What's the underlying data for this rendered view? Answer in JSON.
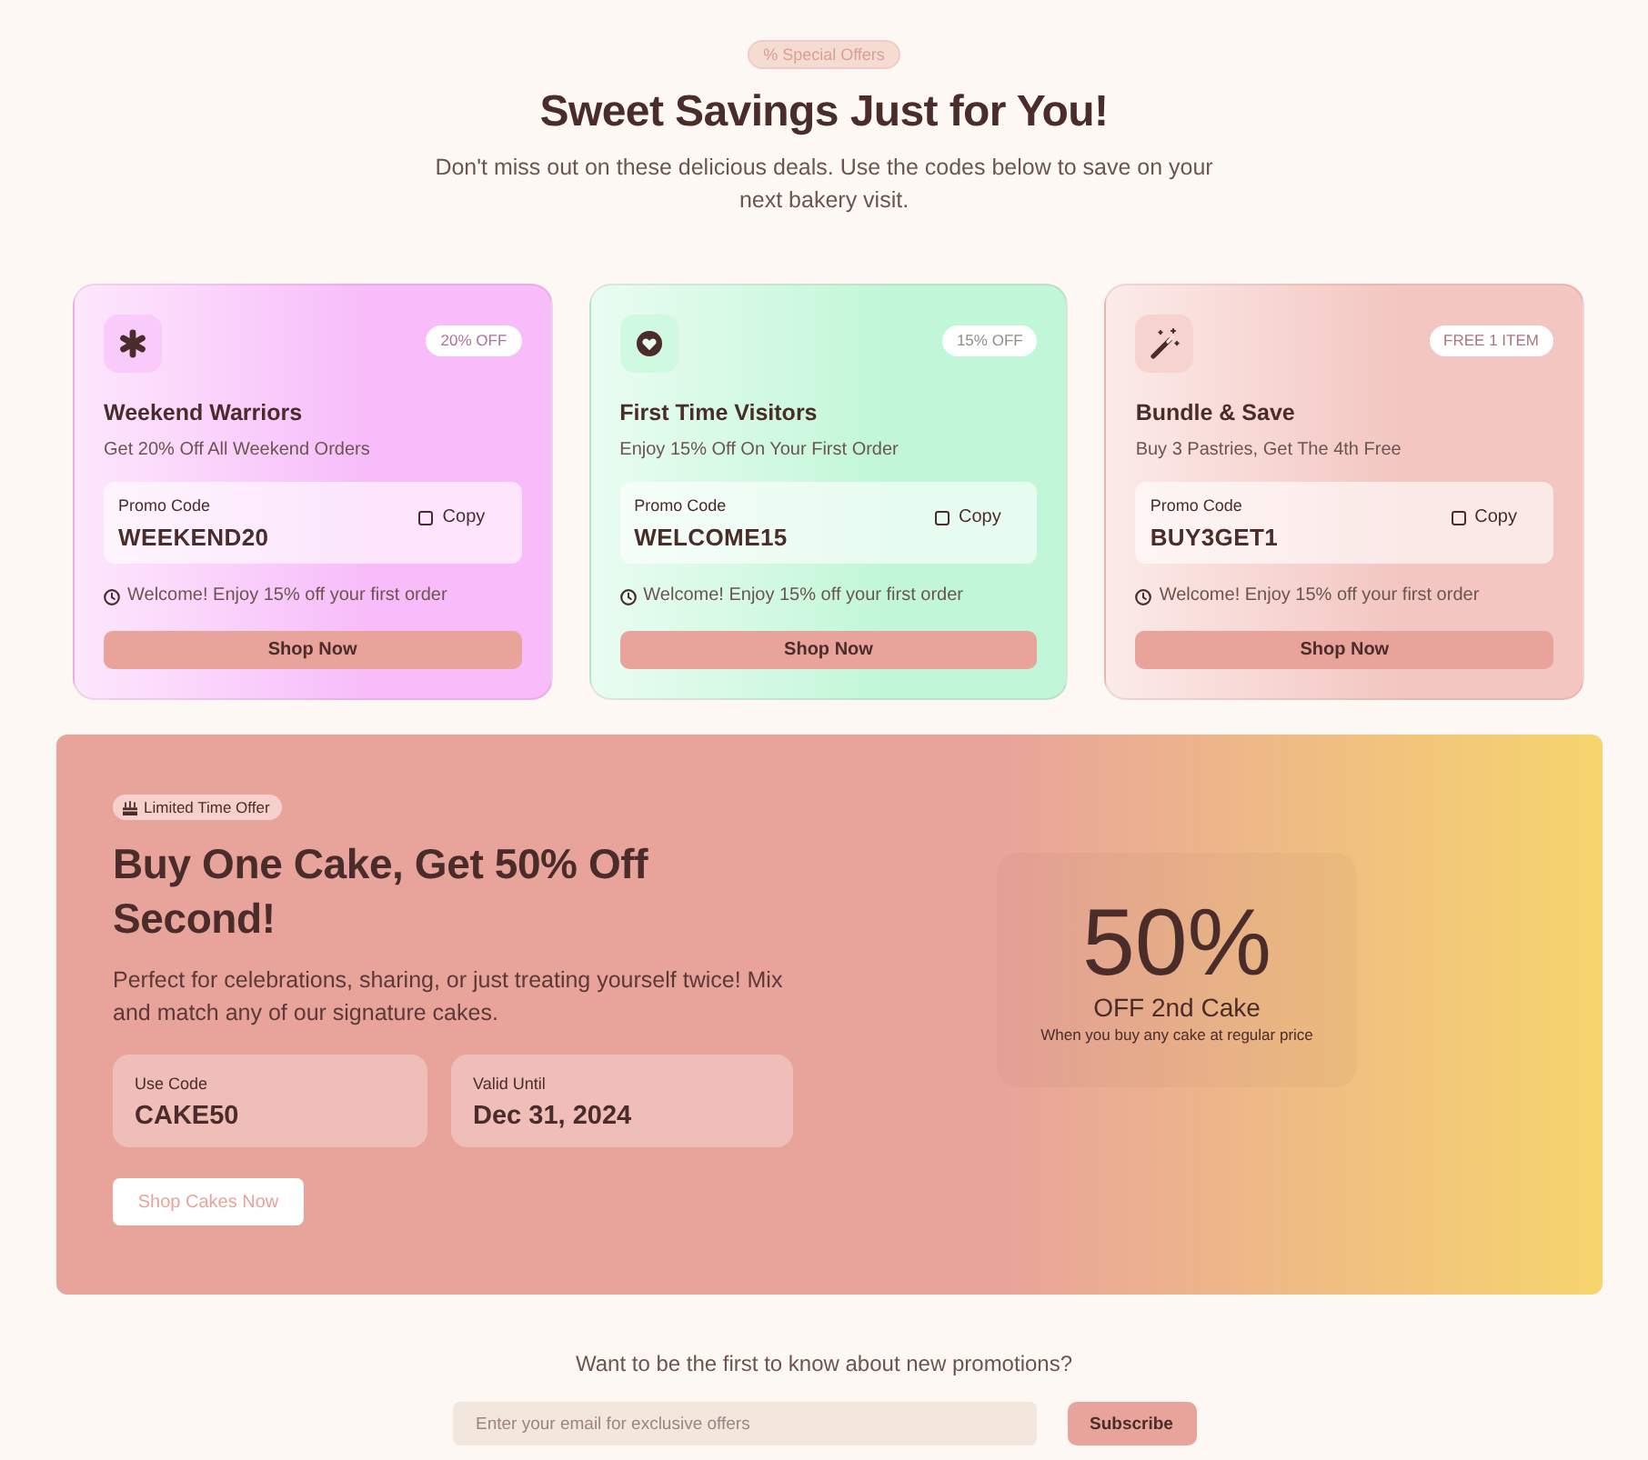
{
  "header": {
    "badge": "% Special Offers",
    "title": "Sweet Savings Just for You!",
    "subtitle": "Don't miss out on these delicious deals. Use the codes below to save on your next bakery visit."
  },
  "offers": [
    {
      "color": "#f7bcf9",
      "badge": "20% OFF",
      "title": "Weekend Warriors",
      "description": "Get 20% Off All Weekend Orders",
      "code_label": "Promo Code",
      "code": "WEEKEND20",
      "copy": "Copy",
      "note": "Welcome! Enjoy 15% off your first order",
      "button": "Shop Now"
    },
    {
      "color": "#c1f7d8",
      "badge": "15% OFF",
      "title": "First Time Visitors",
      "description": "Enjoy 15% Off On Your First Order",
      "code_label": "Promo Code",
      "code": "WELCOME15",
      "copy": "Copy",
      "note": "Welcome! Enjoy 15% off your first order",
      "button": "Shop Now"
    },
    {
      "color": "#f3c6c1",
      "badge": "FREE 1 ITEM",
      "title": "Bundle & Save",
      "description": "Buy 3 Pastries, Get The 4th Free",
      "code_label": "Promo Code",
      "code": "BUY3GET1",
      "copy": "Copy",
      "note": "Welcome! Enjoy 15% off your first order",
      "button": "Shop Now"
    }
  ],
  "banner": {
    "badge": "Limited Time Offer",
    "title": "Buy One Cake, Get 50% Off Second!",
    "text": "Perfect for celebrations, sharing, or just treating yourself twice! Mix and match any of our signature cakes.",
    "details": [
      {
        "label": "Use Code",
        "value": "CAKE50"
      },
      {
        "label": "Valid Until",
        "value": "Dec 31, 2024"
      }
    ],
    "button": "Shop Cakes Now",
    "highlight": {
      "value": "50%",
      "caption": "OFF 2nd Cake",
      "note": "When you buy any cake at regular price"
    }
  },
  "newsletter": {
    "prompt": "Want to be the first to know about new promotions?",
    "placeholder": "Enter your email for exclusive offers",
    "button": "Subscribe"
  }
}
